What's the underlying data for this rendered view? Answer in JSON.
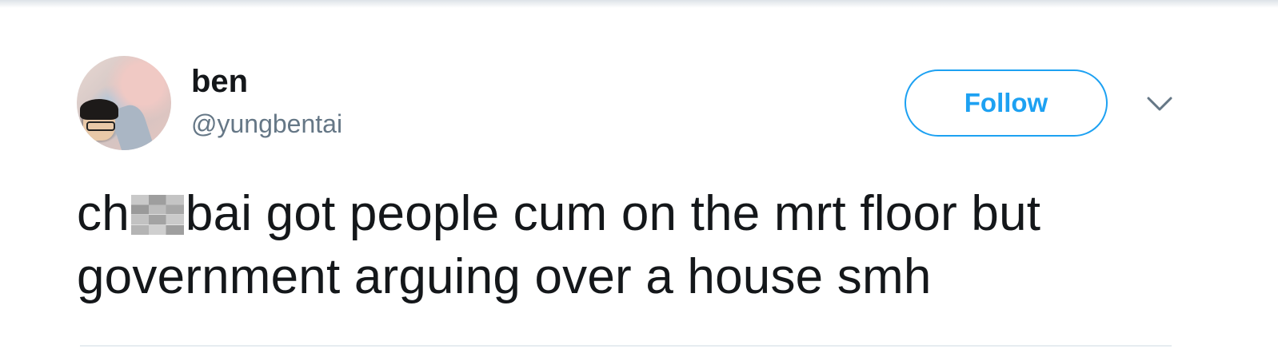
{
  "tweet": {
    "author": {
      "name": "ben",
      "handle": "@yungbentai"
    },
    "follow_label": "Follow",
    "menu_icon": "chevron-down-icon",
    "text": {
      "prefix": "ch",
      "suffix": "bai got people cum on the mrt floor but government arguing over a house smh"
    }
  },
  "colors": {
    "accent": "#1da1f2",
    "handle": "#657786",
    "text": "#14171a"
  }
}
